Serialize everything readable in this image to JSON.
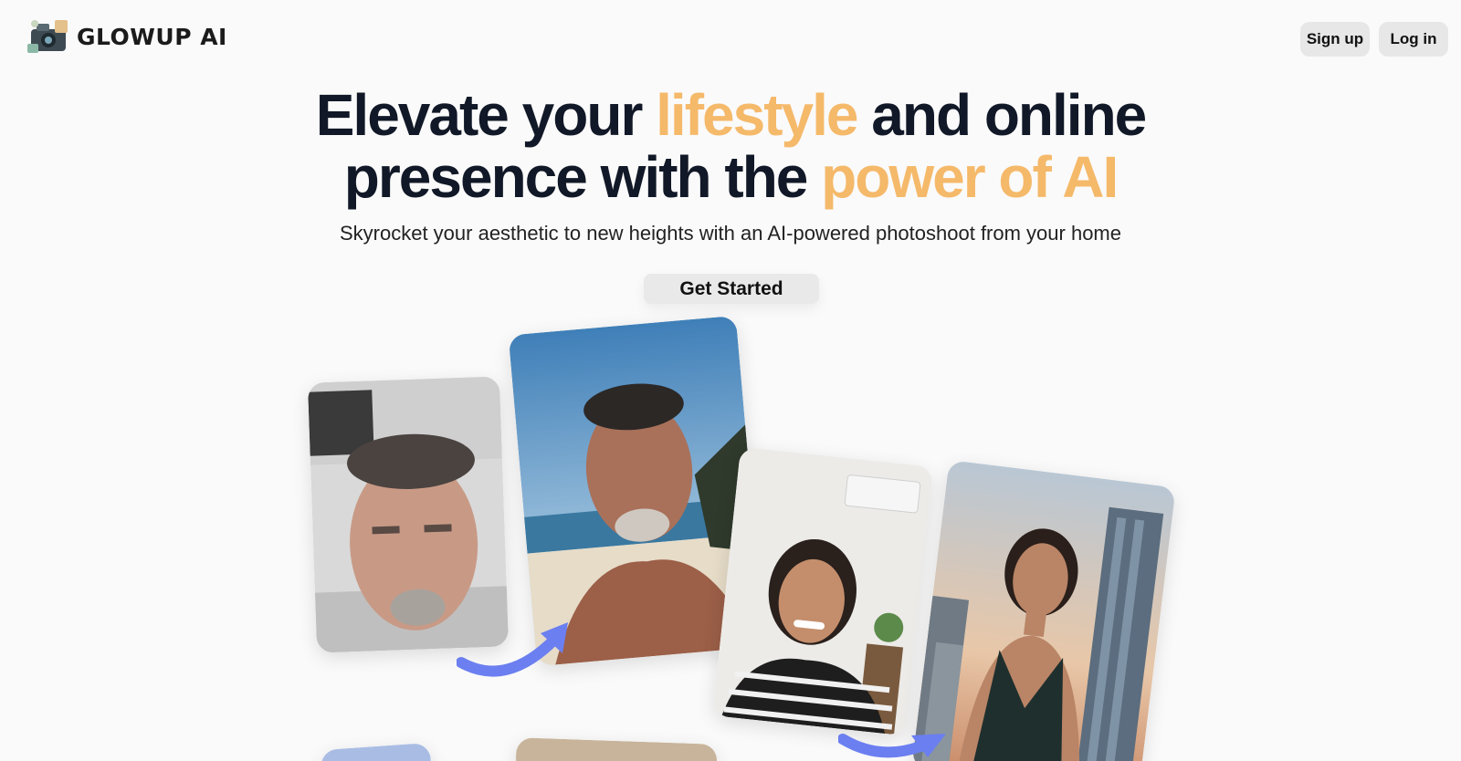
{
  "brand": {
    "name": "GLOWUP AI",
    "logo_icon": "camera-collage-icon"
  },
  "nav": {
    "signup_label": "Sign up",
    "login_label": "Log in"
  },
  "hero": {
    "line1_a": "Elevate your ",
    "line1_accent": "lifestyle",
    "line1_b": " and online",
    "line2_a": "presence with the ",
    "line2_accent": "power of AI",
    "subtitle": "Skyrocket your aesthetic to new heights with an AI-powered photoshoot from your home",
    "cta_label": "Get Started"
  },
  "colors": {
    "accent": "#f5b96a",
    "text": "#111827",
    "button_bg": "#e7e7e7",
    "arrow": "#6b7ff0",
    "background": "#fafafa"
  },
  "gallery": [
    {
      "id": "before-man-selfie"
    },
    {
      "id": "after-man-beach"
    },
    {
      "id": "before-woman-selfie"
    },
    {
      "id": "after-woman-city"
    }
  ]
}
